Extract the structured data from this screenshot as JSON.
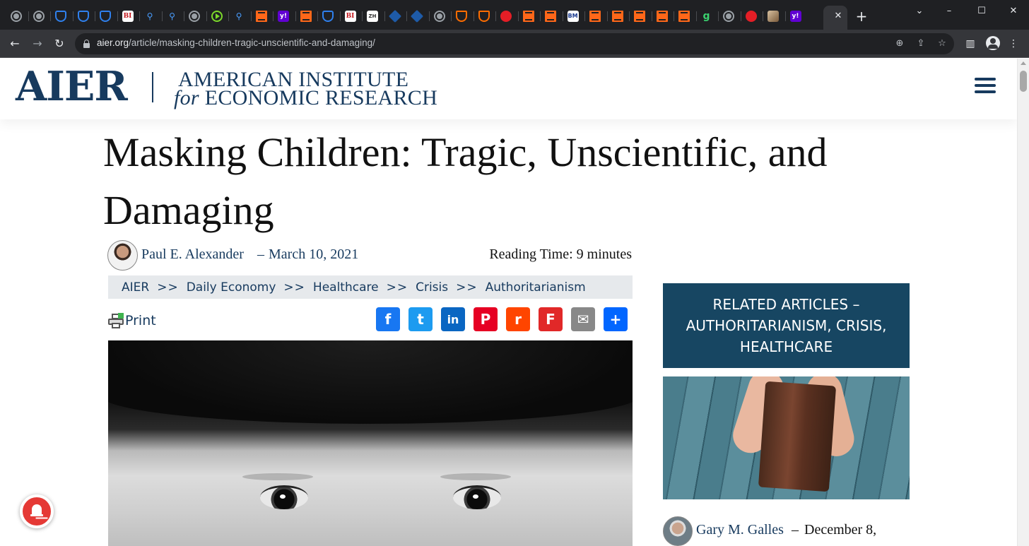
{
  "browser": {
    "tabs": [
      {
        "icon": "globe-icon",
        "text": ""
      },
      {
        "icon": "globe-icon",
        "text": ""
      },
      {
        "icon": "shield-icon",
        "text": ""
      },
      {
        "icon": "shield-icon",
        "text": ""
      },
      {
        "icon": "arrow-icon",
        "text": ""
      },
      {
        "icon": "business-insider-icon",
        "text": "BI"
      },
      {
        "icon": "search-icon",
        "text": "⚲"
      },
      {
        "icon": "search-icon",
        "text": "⚲"
      },
      {
        "icon": "globe-icon",
        "text": ""
      },
      {
        "icon": "rumble-icon",
        "text": ""
      },
      {
        "icon": "search-icon",
        "text": "⚲"
      },
      {
        "icon": "substack-icon",
        "text": ""
      },
      {
        "icon": "yahoo-icon",
        "text": "y!"
      },
      {
        "icon": "substack-icon",
        "text": ""
      },
      {
        "icon": "shield-icon",
        "text": ""
      },
      {
        "icon": "business-insider-icon",
        "text": "BI"
      },
      {
        "icon": "zerohedge-icon",
        "text": "ZH"
      },
      {
        "icon": "cube-icon",
        "text": ""
      },
      {
        "icon": "cube-icon",
        "text": ""
      },
      {
        "icon": "globe-icon",
        "text": ""
      },
      {
        "icon": "brave-shield-icon",
        "text": ""
      },
      {
        "icon": "brave-shield-icon",
        "text": ""
      },
      {
        "icon": "red-pin-icon",
        "text": ""
      },
      {
        "icon": "substack-icon",
        "text": ""
      },
      {
        "icon": "substack-icon",
        "text": ""
      },
      {
        "icon": "bm-icon",
        "text": "BM"
      },
      {
        "icon": "substack-icon",
        "text": ""
      },
      {
        "icon": "substack-icon",
        "text": ""
      },
      {
        "icon": "substack-icon",
        "text": ""
      },
      {
        "icon": "substack-icon",
        "text": ""
      },
      {
        "icon": "substack-icon",
        "text": ""
      },
      {
        "icon": "g-icon",
        "text": "g"
      },
      {
        "icon": "globe-icon",
        "text": ""
      },
      {
        "icon": "red-pin-icon",
        "text": ""
      },
      {
        "icon": "thumbnail-icon",
        "text": ""
      },
      {
        "icon": "yahoo-icon",
        "text": "y!"
      }
    ],
    "url_host": "aier.org",
    "url_path": "/article/masking-children-tragic-unscientific-and-damaging/"
  },
  "site": {
    "logo": "AIER",
    "name_line1": "AMERICAN INSTITUTE",
    "name_for": "for",
    "name_line2": "ECONOMIC RESEARCH"
  },
  "article": {
    "title": "Masking Children: Tragic, Unscientific, and Damaging",
    "author": "Paul E. Alexander",
    "byline_sep": "–",
    "date": "March 10, 2021",
    "reading_time": "Reading Time: 9 minutes",
    "breadcrumbs": [
      "AIER",
      "Daily Economy",
      "Healthcare",
      "Crisis",
      "Authoritarianism"
    ],
    "breadcrumb_sep": ">>",
    "print_label": "Print",
    "share": [
      {
        "name": "facebook-share-button",
        "icon": "facebook-icon",
        "glyph": "f",
        "color": "#1877f2"
      },
      {
        "name": "twitter-share-button",
        "icon": "twitter-icon",
        "glyph": "t",
        "color": "#1d9bf0"
      },
      {
        "name": "linkedin-share-button",
        "icon": "linkedin-icon",
        "glyph": "in",
        "color": "#0a66c2"
      },
      {
        "name": "pinterest-share-button",
        "icon": "pinterest-icon",
        "glyph": "P",
        "color": "#e60023"
      },
      {
        "name": "reddit-share-button",
        "icon": "reddit-icon",
        "glyph": "r",
        "color": "#ff4500"
      },
      {
        "name": "flipboard-share-button",
        "icon": "flipboard-icon",
        "glyph": "F",
        "color": "#e12828"
      },
      {
        "name": "email-share-button",
        "icon": "email-icon",
        "glyph": "✉",
        "color": "#888888"
      },
      {
        "name": "share-button",
        "icon": "share-icon",
        "glyph": "+",
        "color": "#0166ff"
      }
    ]
  },
  "sidebar": {
    "heading_line1": "RELATED ARTICLES –",
    "heading_line2": "AUTHORITARIANISM, CRISIS,",
    "heading_line3": "HEALTHCARE",
    "related": {
      "author": "Gary M. Galles",
      "sep": "–",
      "date": "December 8,"
    }
  },
  "colors": {
    "brand": "#173a5e",
    "related_bg": "#174662",
    "breadcrumb_bg": "#e6e9ec",
    "notification": "#e53935"
  }
}
